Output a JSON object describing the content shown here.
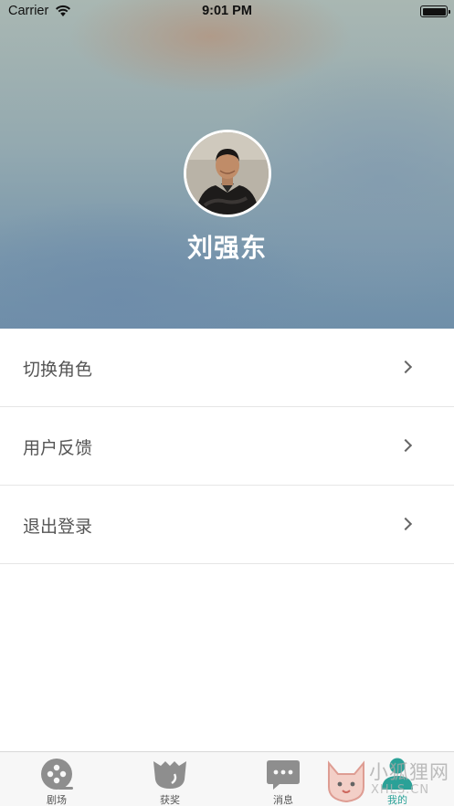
{
  "status_bar": {
    "carrier": "Carrier",
    "time": "9:01 PM",
    "icons": [
      "wifi-icon",
      "battery-icon"
    ]
  },
  "profile": {
    "name": "刘强东",
    "avatar": "avatar-photo"
  },
  "menu": {
    "items": [
      {
        "label": "切换角色",
        "icon": "chevron-right-icon"
      },
      {
        "label": "用户反馈",
        "icon": "chevron-right-icon"
      },
      {
        "label": "退出登录",
        "icon": "chevron-right-icon"
      }
    ]
  },
  "tab_bar": {
    "tabs": [
      {
        "label": "剧场",
        "icon": "film-reel-icon",
        "active": false
      },
      {
        "label": "获奖",
        "icon": "trophy-cup-icon",
        "active": false
      },
      {
        "label": "消息",
        "icon": "chat-bubble-icon",
        "active": false
      },
      {
        "label": "我的",
        "icon": "person-icon",
        "active": true
      }
    ],
    "active_color": "#2aa197",
    "inactive_color": "#8e8e8e"
  },
  "watermark": {
    "text": "小狐狸网",
    "sub": "XHLS.CN"
  }
}
